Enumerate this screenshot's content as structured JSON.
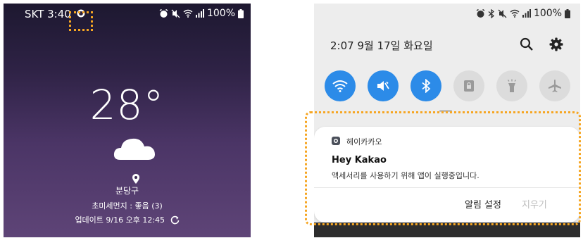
{
  "colors": {
    "highlight": "#f6a623",
    "toggle_active": "#2c8be8",
    "toggle_inactive": "#dcdcdc",
    "wallpaper_top": "#1d1830",
    "wallpaper_bottom": "#5e4477"
  },
  "left_screen": {
    "status_bar": {
      "carrier_time": "SKT 3:40",
      "icons": [
        "recording-icon",
        "alarm-icon",
        "mute-icon",
        "wifi-icon",
        "signal-icon",
        "battery-icon"
      ],
      "battery": "100%"
    },
    "weather": {
      "temperature": "28°",
      "condition_icon": "cloud-icon",
      "location": "분당구",
      "fine_dust": "초미세먼지 : 좋음 (3)",
      "updated": "업데이트 9/16 오후 12:45"
    }
  },
  "right_screen": {
    "status_bar": {
      "icons": [
        "alarm-icon",
        "bluetooth-icon",
        "mute-icon",
        "wifi-icon",
        "signal-icon",
        "battery-icon"
      ],
      "battery": "100%"
    },
    "header": {
      "datetime": "2:07  9월 17일 화요일",
      "search_icon": "search-icon",
      "settings_icon": "gear-icon"
    },
    "quick_toggles": [
      {
        "icon": "wifi-icon",
        "state": "on"
      },
      {
        "icon": "mute-icon",
        "state": "on"
      },
      {
        "icon": "bluetooth-icon",
        "state": "on"
      },
      {
        "icon": "lock-rotation-icon",
        "state": "off"
      },
      {
        "icon": "flashlight-icon",
        "state": "off"
      },
      {
        "icon": "airplane-icon",
        "state": "off"
      }
    ],
    "notification": {
      "app_name": "헤이카카오",
      "title": "Hey Kakao",
      "body": "액세서리를 사용하기 위해 앱이 실행중입니다.",
      "actions": {
        "settings": "알림 설정",
        "clear": "지우기"
      }
    }
  }
}
